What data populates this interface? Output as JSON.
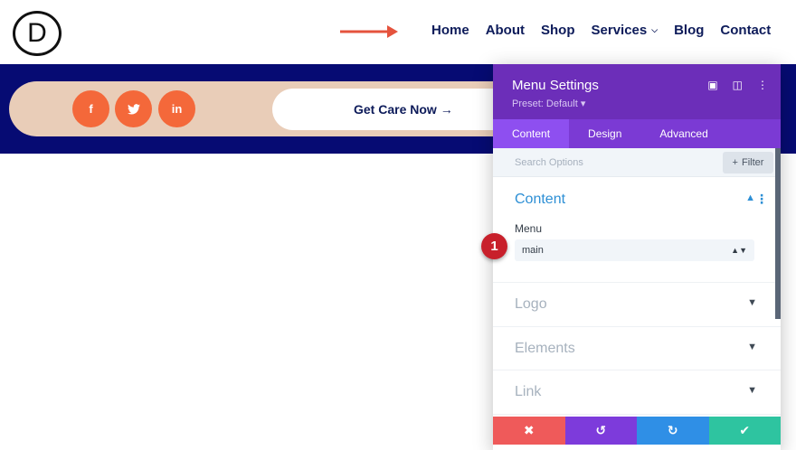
{
  "header": {
    "logo_letter": "D",
    "nav": [
      {
        "label": "Home"
      },
      {
        "label": "About"
      },
      {
        "label": "Shop"
      },
      {
        "label": "Services",
        "has_dropdown": true
      },
      {
        "label": "Blog"
      },
      {
        "label": "Contact"
      }
    ],
    "arrow_color": "#e5533d",
    "nav_color": "#0d1b5a"
  },
  "band": {
    "background": "#060b73",
    "pill_color": "#e9cdb8",
    "social": [
      {
        "icon": "facebook-icon",
        "glyph": "f"
      },
      {
        "icon": "twitter-icon",
        "glyph": "t"
      },
      {
        "icon": "linkedin-icon",
        "glyph": "in"
      }
    ],
    "social_color": "#f4683a",
    "cta_label": "Get Care Now →"
  },
  "panel": {
    "title": "Menu Settings",
    "preset": "Preset: Default ▾",
    "tabs": [
      {
        "label": "Content",
        "active": true
      },
      {
        "label": "Design",
        "active": false
      },
      {
        "label": "Advanced",
        "active": false
      }
    ],
    "search_placeholder": "Search Options",
    "filter_label": "Filter",
    "sections": {
      "content": {
        "title": "Content",
        "field_label": "Menu",
        "selected_value": "main"
      },
      "logo": {
        "title": "Logo"
      },
      "elements": {
        "title": "Elements"
      },
      "link": {
        "title": "Link"
      }
    },
    "header_color": "#6c2eb9",
    "footer": [
      {
        "icon": "close-icon",
        "glyph": "✖",
        "color": "#ef5a5a"
      },
      {
        "icon": "undo-icon",
        "glyph": "↺",
        "color": "#7d3bdb"
      },
      {
        "icon": "redo-icon",
        "glyph": "↻",
        "color": "#2f8fe6"
      },
      {
        "icon": "check-icon",
        "glyph": "✔",
        "color": "#2ec4a0"
      }
    ]
  },
  "annotation": {
    "badge_number": "1"
  }
}
